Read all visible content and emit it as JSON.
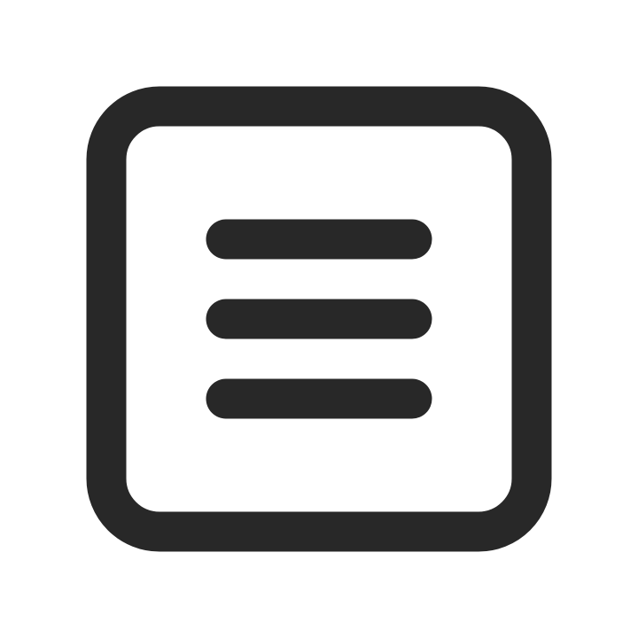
{
  "icon": {
    "name": "menu-square-icon",
    "description_name": "hamburger-menu-in-rounded-square",
    "stroke_color": "#282828",
    "background_color": "#ffffff",
    "line_count": 3
  }
}
